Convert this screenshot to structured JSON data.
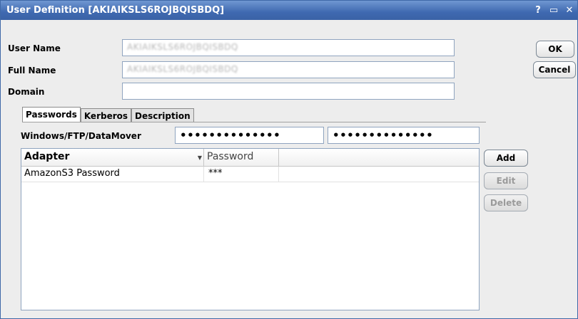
{
  "window": {
    "title": "User Definition [AKIAIKSLS6ROJBQISBDQ]",
    "help_icon": "?",
    "maximize_icon": "▭",
    "close_icon": "✕"
  },
  "form": {
    "user_name_label": "User Name",
    "user_name_value": "AKIAIKSLS6ROJBQISBDQ",
    "full_name_label": "Full Name",
    "full_name_value": "AKIAIKSLS6ROJBQISBDQ",
    "domain_label": "Domain",
    "domain_value": ""
  },
  "buttons": {
    "ok": "OK",
    "cancel": "Cancel",
    "add": "Add",
    "edit": "Edit",
    "delete": "Delete"
  },
  "tabs": [
    "Passwords",
    "Kerberos",
    "Description"
  ],
  "passwords": {
    "label": "Windows/FTP/DataMover",
    "password_mask": "••••••••••••••",
    "confirm_mask": "••••••••••••••"
  },
  "table": {
    "columns": [
      "Adapter",
      "Password",
      ""
    ],
    "rows": [
      [
        "AmazonS3 Password",
        "***",
        ""
      ]
    ]
  }
}
